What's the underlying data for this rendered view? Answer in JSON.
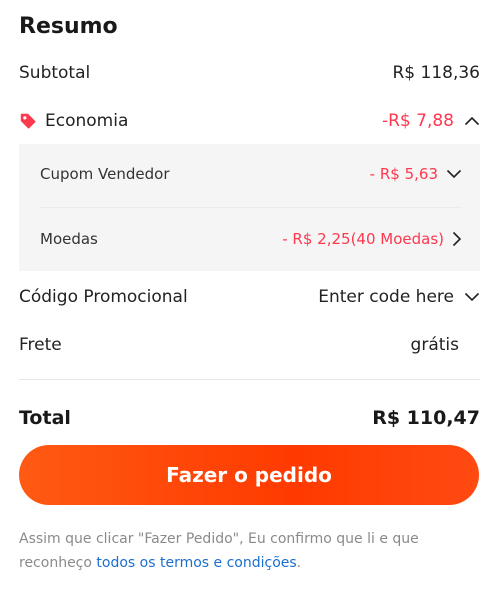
{
  "summary": {
    "title": "Resumo",
    "subtotal": {
      "label": "Subtotal",
      "value": "R$ 118,36"
    },
    "economia": {
      "label": "Economia",
      "value": "-R$ 7,88",
      "icon": "tag-icon",
      "toggle_icon": "chevron-up-icon",
      "items": [
        {
          "label": "Cupom Vendedor",
          "value": "- R$ 5,63",
          "icon": "chevron-down-icon"
        },
        {
          "label": "Moedas",
          "value": "- R$ 2,25(40 Moedas)",
          "icon": "chevron-right-icon"
        }
      ]
    },
    "promo": {
      "label": "Código Promocional",
      "value": "Enter code here",
      "icon": "chevron-down-icon"
    },
    "frete": {
      "label": "Frete",
      "value": "grátis"
    },
    "total": {
      "label": "Total",
      "value": "R$ 110,47"
    }
  },
  "actions": {
    "order_label": "Fazer o pedido"
  },
  "disclaimer": {
    "text": "Assim que clicar \"Fazer Pedido\", Eu confirmo que li e que reconheço ",
    "link": "todos os termos e condições",
    "suffix": "."
  },
  "colors": {
    "accent": "#ff4400",
    "discount": "#fd384f",
    "link": "#1a6fd0"
  }
}
